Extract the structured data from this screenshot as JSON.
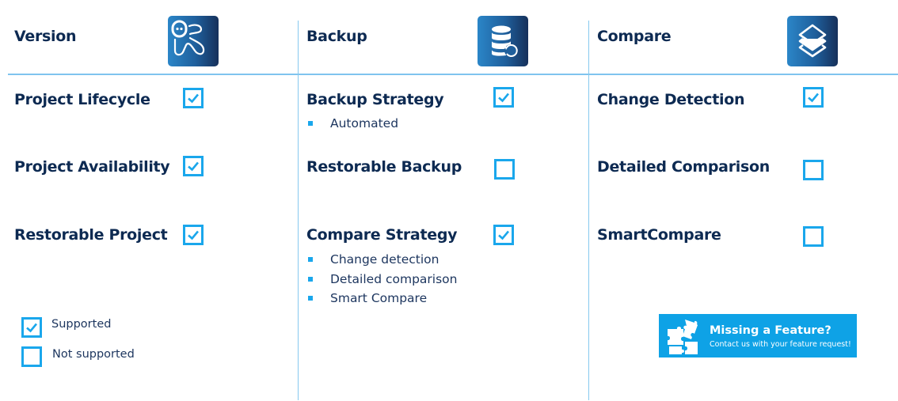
{
  "colors": {
    "text_dark": "#0d2a52",
    "accent": "#1aa7ec",
    "divider": "#7fc4ee",
    "banner_bg": "#0ea2e6"
  },
  "columns": [
    {
      "title": "Version",
      "icon": "octopus-mascot-icon",
      "features": [
        {
          "title": "Project Lifecycle",
          "supported": true,
          "bullets": []
        },
        {
          "title": "Project Availability",
          "supported": true,
          "bullets": []
        },
        {
          "title": "Restorable Project",
          "supported": true,
          "bullets": []
        }
      ]
    },
    {
      "title": "Backup",
      "icon": "database-restore-icon",
      "features": [
        {
          "title": "Backup Strategy",
          "supported": true,
          "bullets": [
            "Automated"
          ]
        },
        {
          "title": "Restorable Backup",
          "supported": false,
          "bullets": []
        },
        {
          "title": "Compare Strategy",
          "supported": true,
          "bullets": [
            "Change detection",
            "Detailed comparison",
            "Smart Compare"
          ]
        }
      ]
    },
    {
      "title": "Compare",
      "icon": "layers-icon",
      "features": [
        {
          "title": "Change Detection",
          "supported": true,
          "bullets": []
        },
        {
          "title": "Detailed Comparison",
          "supported": false,
          "bullets": []
        },
        {
          "title": "SmartCompare",
          "supported": false,
          "bullets": []
        }
      ]
    }
  ],
  "legend": {
    "supported_label": "Supported",
    "not_supported_label": "Not supported"
  },
  "banner": {
    "icon": "puzzle-pieces-icon",
    "title": "Missing a Feature?",
    "subtitle": "Contact us with your feature request!"
  }
}
